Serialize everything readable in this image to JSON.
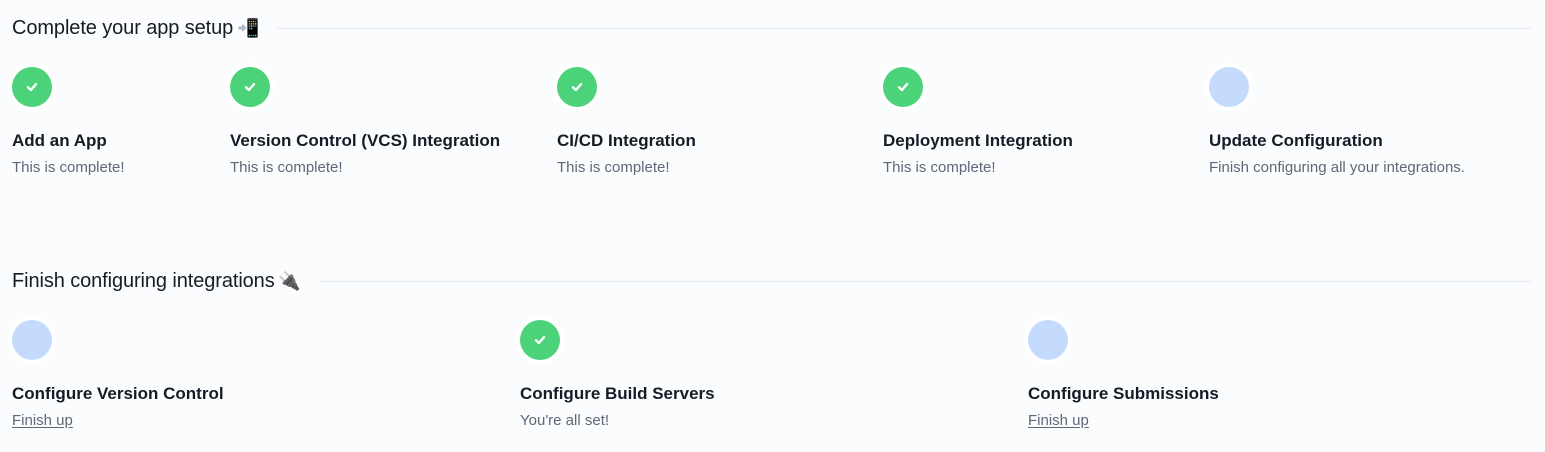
{
  "setup": {
    "title": "Complete your app setup",
    "emoji": "📲",
    "steps": [
      {
        "title": "Add an App",
        "status": "complete",
        "description": "This is complete!"
      },
      {
        "title": "Version Control (VCS) Integration",
        "status": "complete",
        "description": "This is complete!"
      },
      {
        "title": "CI/CD Integration",
        "status": "complete",
        "description": "This is complete!"
      },
      {
        "title": "Deployment Integration",
        "status": "complete",
        "description": "This is complete!"
      },
      {
        "title": "Update Configuration",
        "status": "pending",
        "description": "Finish configuring all your integrations."
      }
    ]
  },
  "integrations": {
    "title": "Finish configuring integrations",
    "emoji": "🔌",
    "steps": [
      {
        "title": "Configure Version Control",
        "status": "pending",
        "link": "Finish up"
      },
      {
        "title": "Configure Build Servers",
        "status": "complete",
        "description": "You're all set!"
      },
      {
        "title": "Configure Submissions",
        "status": "pending",
        "link": "Finish up"
      }
    ]
  },
  "colors": {
    "complete": "#4cd37a",
    "pending": "#c4dbfd",
    "text": "#161b26",
    "muted": "#5f6878"
  },
  "icons": {
    "complete": "checkmark-icon",
    "pending": "empty-circle-icon"
  }
}
